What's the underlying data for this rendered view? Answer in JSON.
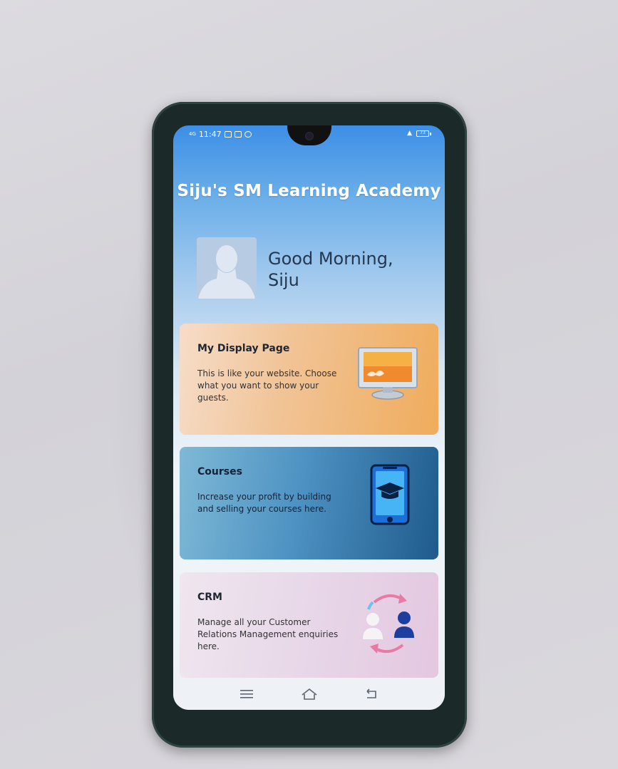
{
  "status_bar": {
    "network": "4G",
    "time": "11:47",
    "battery": "73"
  },
  "app": {
    "title": "Siju's SM Learning Academy"
  },
  "greeting": {
    "line1": "Good Morning,",
    "line2": "Siju"
  },
  "cards": [
    {
      "title": "My Display Page",
      "description": "This is like your website. Choose what you want to show your guests.",
      "icon": "monitor-icon"
    },
    {
      "title": "Courses",
      "description": "Increase your profit by building and selling your courses here.",
      "icon": "phone-graduation-cap-icon"
    },
    {
      "title": "CRM",
      "description": "Manage all your Customer Relations Management enquiries here.",
      "icon": "users-exchange-icon"
    }
  ],
  "colors": {
    "header_blue": "#3d8ee6",
    "display_card": "#efac5c",
    "courses_card": "#1f5b8d",
    "crm_card": "#e4c7e0"
  }
}
